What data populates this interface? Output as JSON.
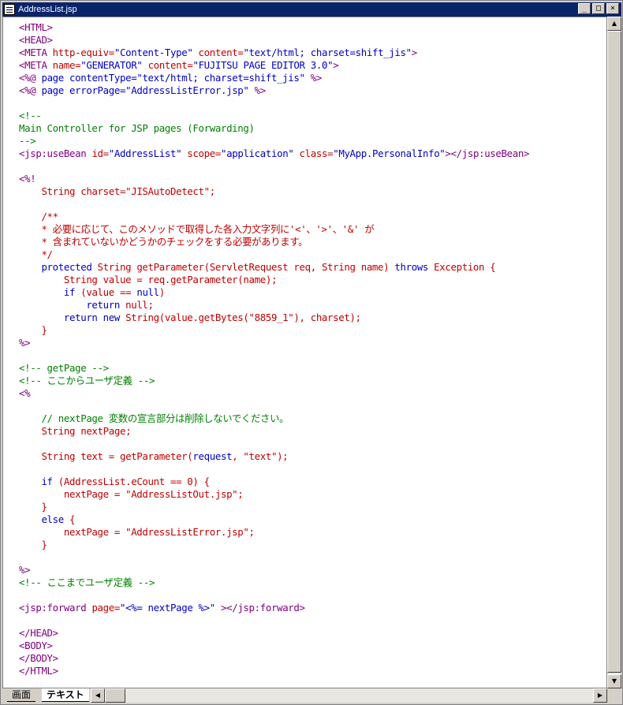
{
  "window": {
    "title": "AddressList.jsp"
  },
  "titlebar_buttons": {
    "minimize": "_",
    "maximize": "□",
    "close": "×"
  },
  "tabs": [
    {
      "label": "画面"
    },
    {
      "label": "テキスト"
    }
  ],
  "code_lines": [
    [
      [
        "tag",
        "<HTML>"
      ]
    ],
    [
      [
        "tag",
        "<HEAD>"
      ]
    ],
    [
      [
        "tag",
        "<META "
      ],
      [
        "attr",
        "http-equiv="
      ],
      [
        "val",
        "\"Content-Type\""
      ],
      [
        "attr",
        " content="
      ],
      [
        "val",
        "\"text/html; charset=shift_jis\""
      ],
      [
        "tag",
        ">"
      ]
    ],
    [
      [
        "tag",
        "<META "
      ],
      [
        "attr",
        "name="
      ],
      [
        "val",
        "\"GENERATOR\""
      ],
      [
        "attr",
        " content="
      ],
      [
        "val",
        "\"FUJITSU PAGE EDITOR 3.0\""
      ],
      [
        "tag",
        ">"
      ]
    ],
    [
      [
        "tag",
        "<%@ "
      ],
      [
        "kw",
        "page contentType="
      ],
      [
        "val",
        "\"text/html; charset=shift_jis\""
      ],
      [
        "tag",
        " %>"
      ]
    ],
    [
      [
        "tag",
        "<%@ "
      ],
      [
        "kw",
        "page errorPage="
      ],
      [
        "val",
        "\"AddressListError.jsp\""
      ],
      [
        "tag",
        " %>"
      ]
    ],
    [],
    [
      [
        "cmt",
        "<!--"
      ]
    ],
    [
      [
        "cmt",
        "Main Controller for JSP pages (Forwarding)"
      ]
    ],
    [
      [
        "cmt",
        "-->"
      ]
    ],
    [
      [
        "tag",
        "<jsp:useBean "
      ],
      [
        "attr",
        "id="
      ],
      [
        "val",
        "\"AddressList\""
      ],
      [
        "attr",
        " scope="
      ],
      [
        "val",
        "\"application\""
      ],
      [
        "attr",
        " class="
      ],
      [
        "val",
        "\"MyApp.PersonalInfo\""
      ],
      [
        "tag",
        "></jsp:useBean>"
      ]
    ],
    [],
    [
      [
        "tag",
        "<%!"
      ]
    ],
    [
      [
        "attr",
        "    String charset="
      ],
      [
        "attr",
        "\"JISAutoDetect\";"
      ]
    ],
    [],
    [
      [
        "attr",
        "    /**"
      ]
    ],
    [
      [
        "attr",
        "    * 必要に応じて、このメソッドで取得した各入力文字列に'<'、'>'、'&' が"
      ]
    ],
    [
      [
        "attr",
        "    * 含まれていないかどうかのチェックをする必要があります。"
      ]
    ],
    [
      [
        "attr",
        "    */"
      ]
    ],
    [
      [
        "kw",
        "    protected "
      ],
      [
        "attr",
        "String getParameter(ServletRequest req, String name) "
      ],
      [
        "kw",
        "throws "
      ],
      [
        "attr",
        "Exception {"
      ]
    ],
    [
      [
        "attr",
        "        String value = req.getParameter(name);"
      ]
    ],
    [
      [
        "kw",
        "        if "
      ],
      [
        "attr",
        "(value == "
      ],
      [
        "kw",
        "null"
      ],
      [
        "attr",
        ")"
      ]
    ],
    [
      [
        "kw",
        "            return "
      ],
      [
        "attr",
        "null;"
      ]
    ],
    [
      [
        "kw",
        "        return new "
      ],
      [
        "attr",
        "String(value.getBytes(\"8859_1\"), charset);"
      ]
    ],
    [
      [
        "attr",
        "    }"
      ]
    ],
    [
      [
        "tag",
        "%>"
      ]
    ],
    [],
    [
      [
        "cmt",
        "<!-- getPage -->"
      ]
    ],
    [
      [
        "cmt",
        "<!-- ここからユーザ定義 -->"
      ]
    ],
    [
      [
        "tag",
        "<%"
      ]
    ],
    [],
    [
      [
        "cmt",
        "    // nextPage 変数の宣言部分は削除しないでください。"
      ]
    ],
    [
      [
        "attr",
        "    String nextPage;"
      ]
    ],
    [],
    [
      [
        "attr",
        "    String text = getParameter("
      ],
      [
        "kw",
        "request"
      ],
      [
        "attr",
        ", \"text\");"
      ]
    ],
    [],
    [
      [
        "kw",
        "    if "
      ],
      [
        "attr",
        "(AddressList.eCount == 0) {"
      ]
    ],
    [
      [
        "attr",
        "        nextPage = \"AddressListOut.jsp\";"
      ]
    ],
    [
      [
        "attr",
        "    }"
      ]
    ],
    [
      [
        "kw",
        "    else "
      ],
      [
        "attr",
        "{"
      ]
    ],
    [
      [
        "attr",
        "        nextPage = \"AddressListError.jsp\";"
      ]
    ],
    [
      [
        "attr",
        "    }"
      ]
    ],
    [],
    [
      [
        "tag",
        "%>"
      ]
    ],
    [
      [
        "cmt",
        "<!-- ここまでユーザ定義 -->"
      ]
    ],
    [],
    [
      [
        "tag",
        "<jsp:forward "
      ],
      [
        "attr",
        "page="
      ],
      [
        "val",
        "\"<%= nextPage %>\""
      ],
      [
        "tag",
        " ></jsp:forward>"
      ]
    ],
    [],
    [
      [
        "tag",
        "</HEAD>"
      ]
    ],
    [
      [
        "tag",
        "<BODY>"
      ]
    ],
    [
      [
        "tag",
        "</BODY>"
      ]
    ],
    [
      [
        "tag",
        "</HTML>"
      ]
    ]
  ]
}
